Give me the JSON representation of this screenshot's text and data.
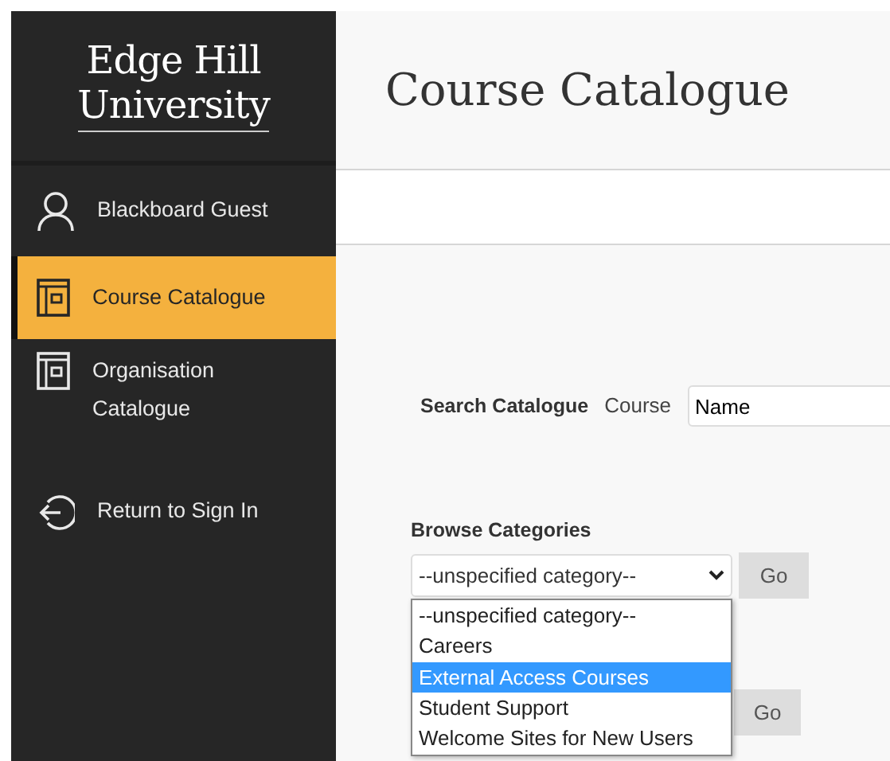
{
  "logo": {
    "lines": [
      "Edge Hill",
      "University"
    ]
  },
  "sidebar": {
    "items": [
      {
        "kind": "user",
        "label": "Blackboard Guest",
        "selected": false
      },
      {
        "kind": "catalogue",
        "label": "Course Catalogue",
        "selected": true
      },
      {
        "kind": "catalogue",
        "label": "Organisation Catalogue",
        "selected": false
      },
      {
        "kind": "signout",
        "label": "Return to Sign In",
        "selected": false
      }
    ]
  },
  "page_title": "Course Catalogue",
  "search": {
    "label": "Search Catalogue",
    "field_label": "Course",
    "value": "Name"
  },
  "browse": {
    "label": "Browse Categories",
    "select_value": "--unspecified category--",
    "button": "Go",
    "options": [
      {
        "label": "--unspecified category--",
        "selected": false
      },
      {
        "label": "Careers",
        "selected": false
      },
      {
        "label": "External Access Courses",
        "selected": true
      },
      {
        "label": "Student Support",
        "selected": false
      },
      {
        "label": "Welcome Sites for New Users",
        "selected": false
      }
    ]
  },
  "second_button": "Go"
}
